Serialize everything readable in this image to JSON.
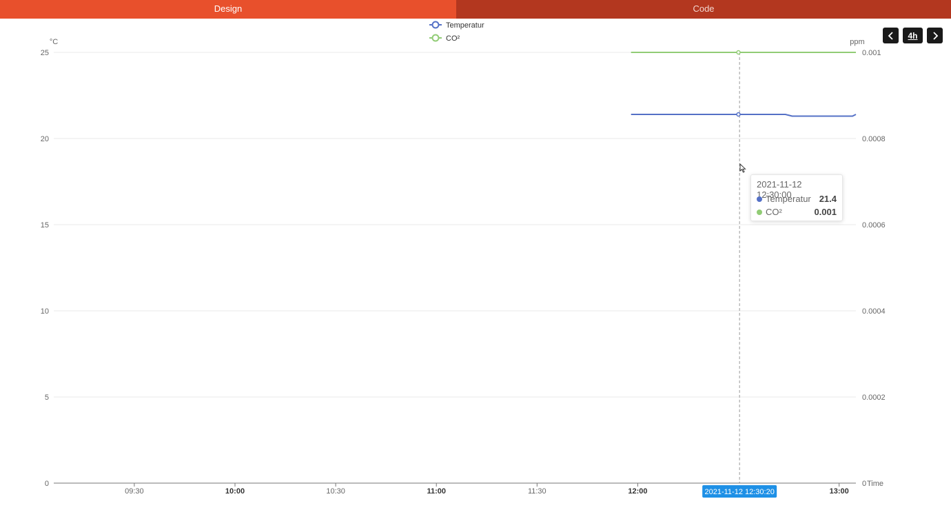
{
  "tabs": [
    {
      "label": "Design",
      "active": true
    },
    {
      "label": "Code",
      "active": false
    }
  ],
  "nav": {
    "prev_icon": "chevron-left-icon",
    "range_label": "4h",
    "next_icon": "chevron-right-icon"
  },
  "colors": {
    "tab_active": "#e8502c",
    "tab_inactive": "#b3371f",
    "temperature": "#5470c6",
    "co2": "#91cc75",
    "pointer_label_bg": "#1e90e6"
  },
  "tooltip": {
    "title": "2021-11-12 12:30:00",
    "rows": [
      {
        "name": "Temperatur",
        "value": "21.4",
        "color": "#5470c6"
      },
      {
        "name": "CO²",
        "value": "0.001",
        "color": "#91cc75"
      }
    ]
  },
  "chart_data": {
    "type": "line",
    "legend": [
      "Temperatur",
      "CO²"
    ],
    "legend_position": "top-center",
    "grid": true,
    "x_axis": {
      "name": "Time",
      "range": [
        "2021-11-12 09:06",
        "2021-11-12 13:05"
      ],
      "ticks": [
        {
          "value": "2021-11-12 09:30",
          "label": "09:30",
          "bold": false
        },
        {
          "value": "2021-11-12 10:00",
          "label": "10:00",
          "bold": true
        },
        {
          "value": "2021-11-12 10:30",
          "label": "10:30",
          "bold": false
        },
        {
          "value": "2021-11-12 11:00",
          "label": "11:00",
          "bold": true
        },
        {
          "value": "2021-11-12 11:30",
          "label": "11:30",
          "bold": false
        },
        {
          "value": "2021-11-12 12:00",
          "label": "12:00",
          "bold": true
        },
        {
          "value": "2021-11-12 13:00",
          "label": "13:00",
          "bold": true
        }
      ],
      "pointer_value": "2021-11-12 12:30:20",
      "pointer_label": "2021-11-12 12:30:20"
    },
    "y_axis_left": {
      "name": "°C",
      "ylim": [
        0,
        25
      ],
      "ticks": [
        {
          "value": 0,
          "label": "0"
        },
        {
          "value": 5,
          "label": "5"
        },
        {
          "value": 10,
          "label": "10"
        },
        {
          "value": 15,
          "label": "15"
        },
        {
          "value": 20,
          "label": "20"
        },
        {
          "value": 25,
          "label": "25"
        }
      ]
    },
    "y_axis_right": {
      "name": "ppm",
      "ylim": [
        0,
        0.001
      ],
      "ticks": [
        {
          "value": 0,
          "label": "0"
        },
        {
          "value": 0.0002,
          "label": "0.0002"
        },
        {
          "value": 0.0004,
          "label": "0.0004"
        },
        {
          "value": 0.0006,
          "label": "0.0006"
        },
        {
          "value": 0.0008,
          "label": "0.0008"
        },
        {
          "value": 0.001,
          "label": "0.001"
        }
      ]
    },
    "series": [
      {
        "name": "Temperatur",
        "axis": "left",
        "color": "#5470c6",
        "highlight": "2021-11-12 12:30:00",
        "points": [
          {
            "x": "2021-11-12 11:58",
            "y": 21.4
          },
          {
            "x": "2021-11-12 12:30",
            "y": 21.4
          },
          {
            "x": "2021-11-12 12:44",
            "y": 21.4
          },
          {
            "x": "2021-11-12 12:46",
            "y": 21.3
          },
          {
            "x": "2021-11-12 13:04",
            "y": 21.3
          },
          {
            "x": "2021-11-12 13:05",
            "y": 21.4
          }
        ]
      },
      {
        "name": "CO²",
        "axis": "right",
        "color": "#91cc75",
        "highlight": "2021-11-12 12:30:00",
        "points": [
          {
            "x": "2021-11-12 11:58",
            "y": 0.001
          },
          {
            "x": "2021-11-12 12:30",
            "y": 0.001
          },
          {
            "x": "2021-11-12 13:05",
            "y": 0.001
          }
        ]
      }
    ]
  }
}
